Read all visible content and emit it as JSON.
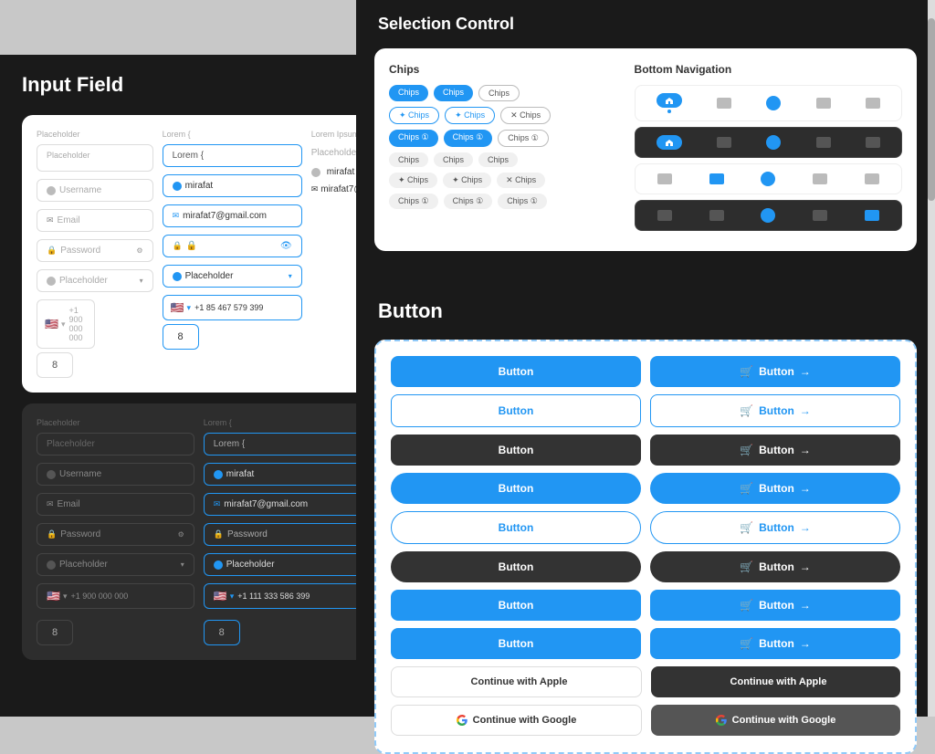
{
  "inputField": {
    "title": "Input Field",
    "lightCard": {
      "label": "Placeholder",
      "fields": [
        {
          "type": "username",
          "placeholder": "Username",
          "value": "mirafat"
        },
        {
          "type": "email",
          "placeholder": "Email",
          "value": "mirafat7@gmail.com"
        },
        {
          "type": "password",
          "placeholder": "Password",
          "value": ""
        },
        {
          "type": "dropdown",
          "placeholder": "Placeholder",
          "value": "Placeholder"
        },
        {
          "type": "phone",
          "placeholder": "+1 900 000 000",
          "value": "+1 85 467 579 399"
        }
      ],
      "loremLabel": "Lorem {",
      "loremRightLabel": "Lorem Ipsum"
    },
    "darkCard": {
      "label": "Placeholder",
      "fields": [
        {
          "type": "username",
          "placeholder": "Username",
          "value": "mirafat"
        },
        {
          "type": "email",
          "placeholder": "Email",
          "value": "mirafat7@gmail.com"
        },
        {
          "type": "password",
          "placeholder": "Password",
          "value": "Password"
        },
        {
          "type": "dropdown",
          "placeholder": "Placeholder",
          "value": "Placeholder"
        },
        {
          "type": "phone",
          "placeholder": "+1 900 000 000",
          "value": "+1 111 333 586 399"
        }
      ],
      "loremLabel": "Lorem {"
    }
  },
  "selectionControl": {
    "title": "Selection Control",
    "chips": {
      "sectionTitle": "Chips",
      "rows": [
        [
          "Chips",
          "Chips",
          "Chips"
        ],
        [
          "Chips",
          "Chips",
          "Chips"
        ],
        [
          "Chips",
          "Chips",
          "Chips"
        ],
        [
          "Chips",
          "Chips",
          "Chips"
        ],
        [
          "Chips",
          "Chips",
          "Chips"
        ],
        [
          "Chips",
          "Chips",
          "Chips"
        ]
      ]
    },
    "bottomNav": {
      "sectionTitle": "Bottom Navigation"
    }
  },
  "button": {
    "title": "Button",
    "rows": [
      {
        "left": {
          "label": "Button",
          "style": "blue-filled"
        },
        "right": {
          "label": "Button",
          "style": "blue-filled-icon"
        }
      },
      {
        "left": {
          "label": "Button",
          "style": "blue-outline"
        },
        "right": {
          "label": "Button",
          "style": "blue-outline-icon"
        }
      },
      {
        "left": {
          "label": "Button",
          "style": "dark-filled"
        },
        "right": {
          "label": "Button",
          "style": "dark-filled-icon"
        }
      },
      {
        "left": {
          "label": "Button",
          "style": "blue-filled-rounded"
        },
        "right": {
          "label": "Button",
          "style": "blue-filled-icon-rounded"
        }
      },
      {
        "left": {
          "label": "Button",
          "style": "blue-outline-rounded"
        },
        "right": {
          "label": "Button",
          "style": "blue-outline-icon-rounded"
        }
      },
      {
        "left": {
          "label": "Button",
          "style": "dark-filled-rounded"
        },
        "right": {
          "label": "Button",
          "style": "dark-filled-icon-rounded"
        }
      },
      {
        "left": {
          "label": "Button",
          "style": "blue-filled"
        },
        "right": {
          "label": "Button",
          "style": "blue-filled-icon"
        }
      },
      {
        "left": {
          "label": "Button",
          "style": "blue-filled"
        },
        "right": {
          "label": "Button",
          "style": "blue-filled-icon"
        }
      }
    ],
    "appleLight": "Continue with Apple",
    "appleDark": "Continue with Apple",
    "googleLight": "Continue with Google",
    "googleDark": "Continue with Google"
  }
}
